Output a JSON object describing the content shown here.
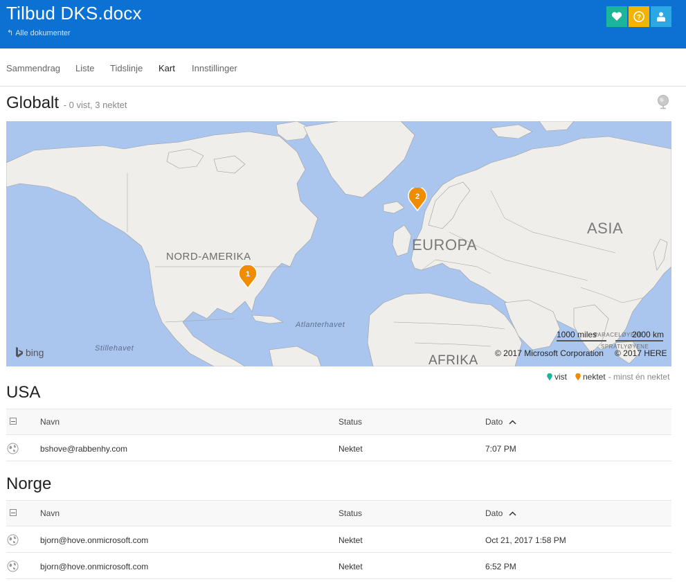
{
  "header": {
    "title": "Tilbud DKS.docx",
    "back_label": "Alle dokumenter",
    "buttons": [
      {
        "name": "heart-icon",
        "color": "#1bb59a"
      },
      {
        "name": "help-icon",
        "color": "#f2b400"
      },
      {
        "name": "user-icon",
        "color": "#2ba7e4"
      }
    ],
    "background": "#0b72d4"
  },
  "tabs": [
    {
      "label": "Sammendrag",
      "active": false
    },
    {
      "label": "Liste",
      "active": false
    },
    {
      "label": "Tidslinje",
      "active": false
    },
    {
      "label": "Kart",
      "active": true
    },
    {
      "label": "Innstillinger",
      "active": false
    }
  ],
  "global": {
    "title": "Globalt",
    "subtitle": "- 0 vist, 3 nektet"
  },
  "map": {
    "labels": {
      "north_america": "NORD-AMERIKA",
      "europe": "EUROPA",
      "asia": "ASIA",
      "africa": "AFRIKA",
      "atlantic": "Atlanterhavet",
      "pacific": "Stillehavet",
      "paracel": "PARACELØYENE",
      "spratly": "SPRATLYØYENE"
    },
    "pins": [
      {
        "label": "1",
        "location": "USA"
      },
      {
        "label": "2",
        "location": "Norge"
      }
    ],
    "pin_color": "#f08c00",
    "bing_label": "bing",
    "scale_miles": "1000 miles",
    "scale_km": "2000 km",
    "copyright_ms": "© 2017 Microsoft Corporation",
    "copyright_here": "© 2017 HERE"
  },
  "legend": {
    "viewed": "vist",
    "denied": "nektet",
    "note": "- minst én nektet",
    "viewed_color": "#1bb59a",
    "denied_color": "#f08c00"
  },
  "columns": {
    "name": "Navn",
    "status": "Status",
    "date": "Dato"
  },
  "groups": [
    {
      "title": "USA",
      "rows": [
        {
          "name": "bshove@rabbenhy.com",
          "status": "Nektet",
          "date": "7:07 PM"
        }
      ]
    },
    {
      "title": "Norge",
      "rows": [
        {
          "name": "bjorn@hove.onmicrosoft.com",
          "status": "Nektet",
          "date": "Oct 21, 2017 1:58 PM"
        },
        {
          "name": "bjorn@hove.onmicrosoft.com",
          "status": "Nektet",
          "date": "6:52 PM"
        }
      ]
    }
  ]
}
